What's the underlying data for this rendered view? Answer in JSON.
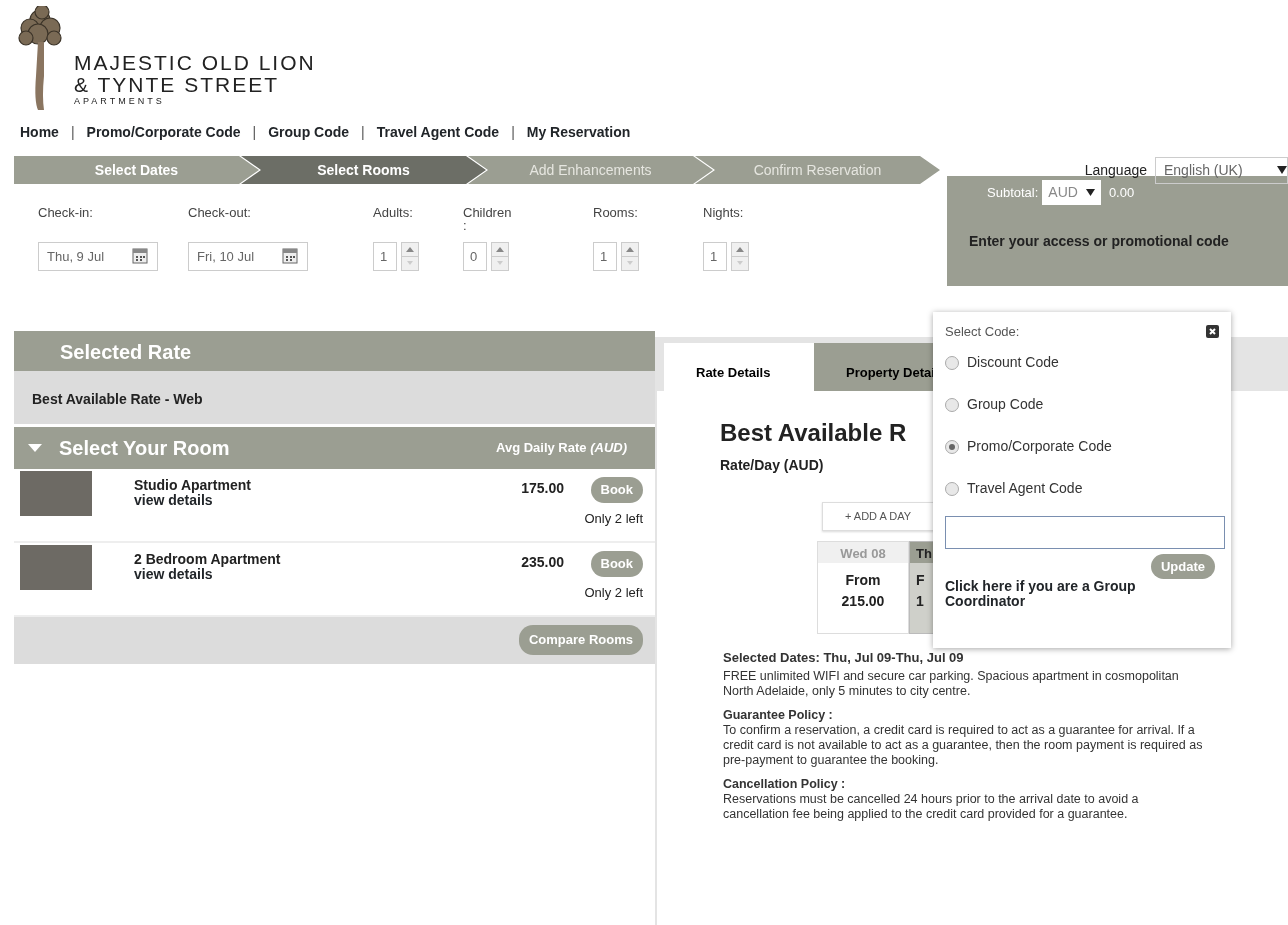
{
  "logo": {
    "line1": "MAJESTIC OLD LION",
    "line2": "& TYNTE STREET",
    "line3": "APARTMENTS"
  },
  "nav": {
    "items": [
      "Home",
      "Promo/Corporate Code",
      "Group Code",
      "Travel Agent Code",
      "My Reservation"
    ],
    "separators": [
      "|",
      "|",
      "|",
      "|"
    ]
  },
  "steps": [
    {
      "label": "Select Dates",
      "completed": true,
      "selected": false
    },
    {
      "label": "Select Rooms",
      "completed": false,
      "selected": true
    },
    {
      "label": "Add Enhancements",
      "completed": false,
      "selected": false
    },
    {
      "label": "Confirm Reservation",
      "completed": false,
      "selected": false
    }
  ],
  "search": [
    {
      "label": "Check-in:",
      "kind": "date",
      "value": "Thu, 9 Jul"
    },
    {
      "label": "Check-out:",
      "kind": "date",
      "value": "Fri, 10 Jul"
    },
    {
      "label": "Adults:",
      "kind": "spinner",
      "value": "1"
    },
    {
      "label": "Children\n:",
      "kind": "spinner",
      "value": "0"
    },
    {
      "label": "Rooms:",
      "kind": "spinner",
      "value": "1"
    },
    {
      "label": "Nights:",
      "kind": "spinner",
      "value": "1"
    }
  ],
  "language": {
    "label": "Language",
    "value": "English (UK)"
  },
  "subtotal": {
    "label": "Subtotal:",
    "currency": "AUD",
    "amount": "0.00"
  },
  "promo_prompt": "Enter your access or promotional code",
  "selected_rate": {
    "title": "Selected Rate",
    "name": "Best Available Rate - Web"
  },
  "rooms": {
    "title": "Select Your Room",
    "rate_label": "Avg Daily Rate *(AUD)*",
    "items": [
      {
        "name": "Studio Apartment",
        "link": "view details",
        "price": "175.00",
        "button": "Book",
        "availability": "Only 2 left"
      },
      {
        "name": "2 Bedroom Apartment",
        "link": "view details",
        "price": "235.00",
        "button": "Book",
        "availability": "Only 2 left"
      }
    ],
    "compare_button": "Compare Rooms"
  },
  "details": {
    "tabs": [
      {
        "label": "Rate Details",
        "selected": true
      },
      {
        "label": "Property Detai",
        "selected": false
      }
    ],
    "heading": "Best Available R",
    "subheading": "Rate/Day (AUD)",
    "add_day": "+ ADD A DAY",
    "days": [
      {
        "day": "Wed 08",
        "from": "From",
        "price": "215.00",
        "selected": false
      },
      {
        "day": "Th",
        "from": "F",
        "price": "1",
        "selected": true
      }
    ],
    "selected_dates": "Selected Dates: Thu, Jul 09-Thu, Jul 09",
    "description": "FREE unlimited WIFI and secure car parking. Spacious apartment in cosmopolitan North Adelaide, only 5 minutes to city centre.",
    "policies": [
      {
        "title": "Guarantee Policy :",
        "text": "To confirm a reservation, a credit card is required to act as a guarantee for arrival. If a credit card is not available to act as a guarantee, then the room payment is required as pre-payment to guarantee the booking."
      },
      {
        "title": "Cancellation Policy :",
        "text": "Reservations must be cancelled 24 hours prior to the arrival date to avoid a cancellation fee being applied to the credit card provided for a guarantee."
      }
    ]
  },
  "code_popup": {
    "title": "Select Code:",
    "options": [
      {
        "label": "Discount Code",
        "selected": false
      },
      {
        "label": "Group Code",
        "selected": false
      },
      {
        "label": "Promo/Corporate Code",
        "selected": true
      },
      {
        "label": "Travel Agent Code",
        "selected": false
      }
    ],
    "button": "Update",
    "group_link": "Click here if you are a Group Coordinator"
  }
}
